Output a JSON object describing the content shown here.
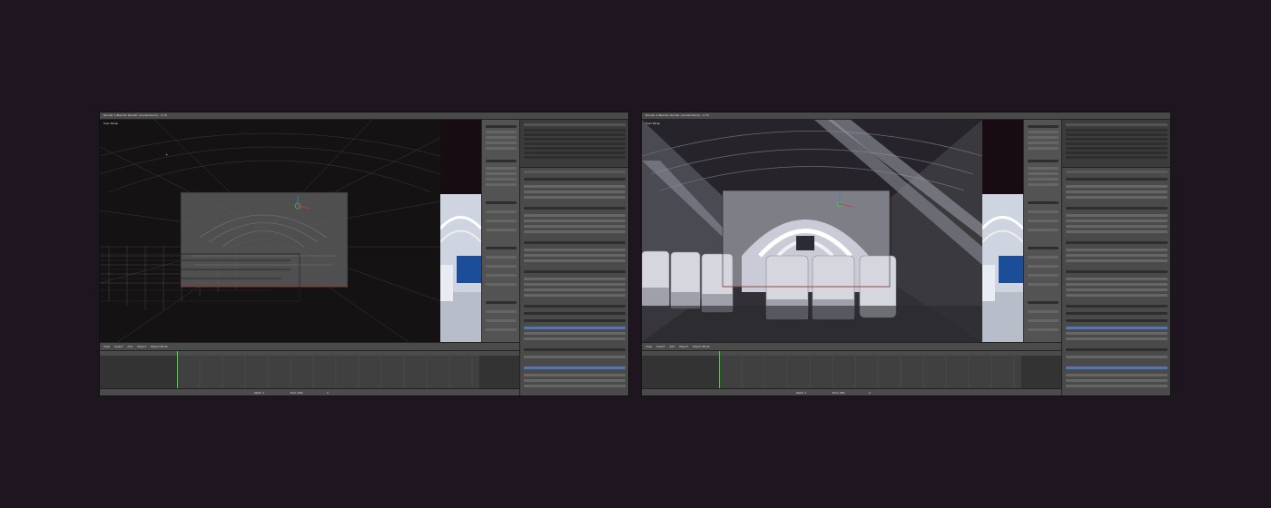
{
  "screens": [
    {
      "id": "left",
      "top_bar": {
        "title": "Render 1 Blender Render (render.blend) - 2.79"
      },
      "viewport": {
        "mode": "wireframe",
        "label": "User Persp"
      },
      "viewport_header": {
        "view": "View",
        "select": "Select",
        "add": "Add",
        "object": "Object",
        "mode": "Object Mode"
      },
      "timeline_header": {
        "start": "Start: 1",
        "end": "End: 250",
        "frame": "1"
      }
    },
    {
      "id": "right",
      "top_bar": {
        "title": "Render 1 Blender Render (render.blend) - 2.79"
      },
      "viewport": {
        "mode": "solid",
        "label": "User Persp"
      },
      "viewport_header": {
        "view": "View",
        "select": "Select",
        "add": "Add",
        "object": "Object",
        "mode": "Object Mode"
      },
      "timeline_header": {
        "start": "Start: 1",
        "end": "End: 250",
        "frame": "1"
      }
    }
  ],
  "colors": {
    "page_background": "#1f1520",
    "ui_panel": "#4a4a4a",
    "accent_blue": "#5377b6",
    "camera_frame_red": "#b8343a",
    "cursor_green": "#3fd13f"
  }
}
